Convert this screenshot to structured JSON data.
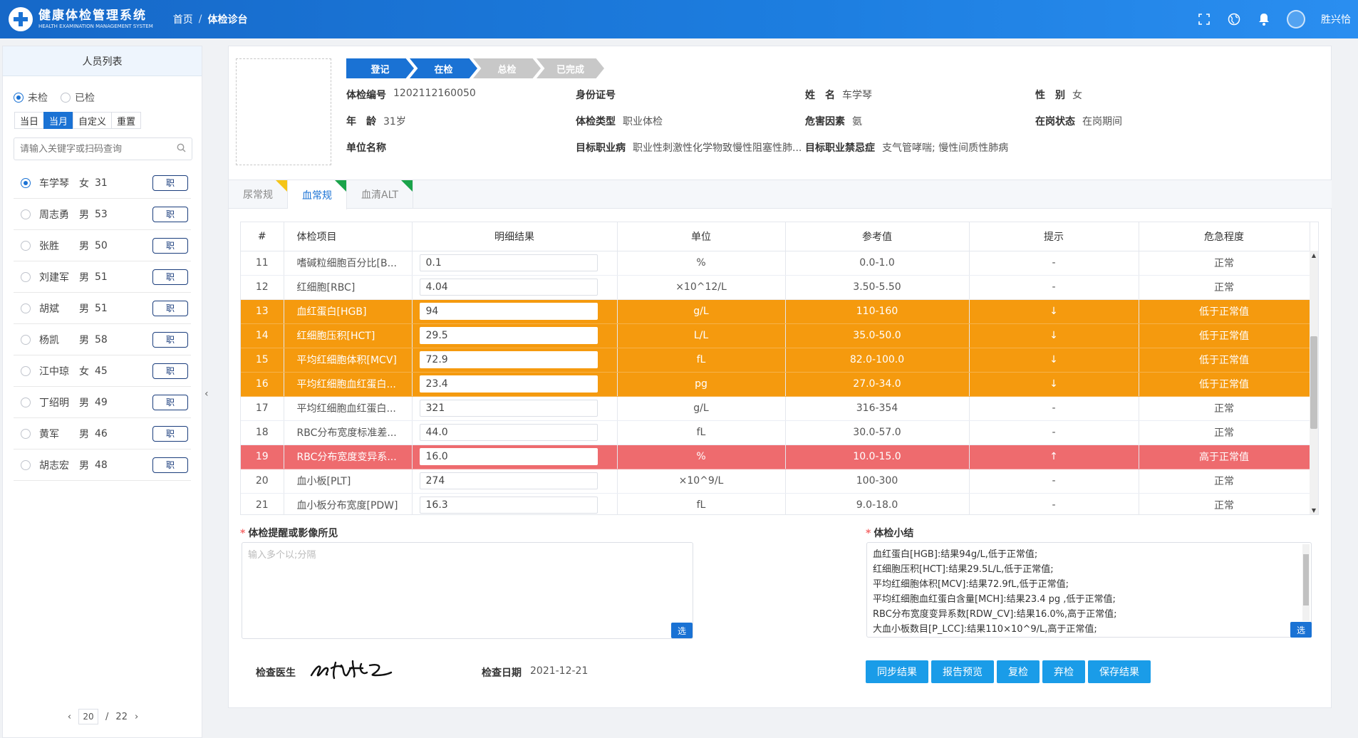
{
  "header": {
    "app_title": "健康体检管理系统",
    "app_subtitle": "HEALTH EXAMINATION MANAGEMENT SYSTEM",
    "breadcrumb_home": "首页",
    "breadcrumb_sep": "/",
    "breadcrumb_current": "体检诊台",
    "username": "胜兴恰"
  },
  "sidebar": {
    "title": "人员列表",
    "status_options": [
      "未检",
      "已检"
    ],
    "date_filters": [
      "当日",
      "当月",
      "自定义",
      "重置"
    ],
    "search_placeholder": "请输入关键字或扫码查询",
    "people": [
      {
        "name": "车学琴",
        "sex": "女",
        "age": "31",
        "tag": "职"
      },
      {
        "name": "周志勇",
        "sex": "男",
        "age": "53",
        "tag": "职"
      },
      {
        "name": "张胜",
        "sex": "男",
        "age": "50",
        "tag": "职"
      },
      {
        "name": "刘建军",
        "sex": "男",
        "age": "51",
        "tag": "职"
      },
      {
        "name": "胡斌",
        "sex": "男",
        "age": "51",
        "tag": "职"
      },
      {
        "name": "杨凯",
        "sex": "男",
        "age": "58",
        "tag": "职"
      },
      {
        "name": "江中琼",
        "sex": "女",
        "age": "45",
        "tag": "职"
      },
      {
        "name": "丁绍明",
        "sex": "男",
        "age": "49",
        "tag": "职"
      },
      {
        "name": "黄军",
        "sex": "男",
        "age": "46",
        "tag": "职"
      },
      {
        "name": "胡志宏",
        "sex": "男",
        "age": "48",
        "tag": "职"
      }
    ],
    "pager": {
      "prev": "‹",
      "current": "20",
      "sep": "/",
      "total": "22",
      "next": "›"
    }
  },
  "steps": [
    "登记",
    "在检",
    "总检",
    "已完成"
  ],
  "patient": {
    "exam_no_label": "体检编号",
    "exam_no": "1202112160050",
    "id_label": "身份证号",
    "id_value": "",
    "name_label": "姓　名",
    "name": "车学琴",
    "sex_label": "性　别",
    "sex": "女",
    "age_label": "年　龄",
    "age": "31岁",
    "type_label": "体检类型",
    "type": "职业体检",
    "hazard_label": "危害因素",
    "hazard": "氨",
    "post_label": "在岗状态",
    "post": "在岗期间",
    "unit_label": "单位名称",
    "unit": "",
    "target_label": "目标职业病",
    "target": "职业性刺激性化学物致慢性阻塞性肺...",
    "contra_label": "目标职业禁忌症",
    "contra": "支气管哮喘; 慢性间质性肺病"
  },
  "tabs": [
    "尿常规",
    "血常规",
    "血清ALT"
  ],
  "table": {
    "headers": [
      "#",
      "体检项目",
      "明细结果",
      "单位",
      "参考值",
      "提示",
      "危急程度"
    ],
    "rows": [
      {
        "no": "11",
        "item": "嗜碱粒细胞百分比[B...",
        "result": "0.1",
        "unit": "%",
        "ref": "0.0-1.0",
        "hint": "-",
        "level": "正常"
      },
      {
        "no": "12",
        "item": "红细胞[RBC]",
        "result": "4.04",
        "unit": "×10^12/L",
        "ref": "3.50-5.50",
        "hint": "-",
        "level": "正常"
      },
      {
        "no": "13",
        "item": "血红蛋白[HGB]",
        "result": "94",
        "unit": "g/L",
        "ref": "110-160",
        "hint": "↓",
        "level": "低于正常值"
      },
      {
        "no": "14",
        "item": "红细胞压积[HCT]",
        "result": "29.5",
        "unit": "L/L",
        "ref": "35.0-50.0",
        "hint": "↓",
        "level": "低于正常值"
      },
      {
        "no": "15",
        "item": "平均红细胞体积[MCV]",
        "result": "72.9",
        "unit": "fL",
        "ref": "82.0-100.0",
        "hint": "↓",
        "level": "低于正常值"
      },
      {
        "no": "16",
        "item": "平均红细胞血红蛋白...",
        "result": "23.4",
        "unit": "pg",
        "ref": "27.0-34.0",
        "hint": "↓",
        "level": "低于正常值"
      },
      {
        "no": "17",
        "item": "平均红细胞血红蛋白...",
        "result": "321",
        "unit": "g/L",
        "ref": "316-354",
        "hint": "-",
        "level": "正常"
      },
      {
        "no": "18",
        "item": "RBC分布宽度标准差...",
        "result": "44.0",
        "unit": "fL",
        "ref": "30.0-57.0",
        "hint": "-",
        "level": "正常"
      },
      {
        "no": "19",
        "item": "RBC分布宽度变异系...",
        "result": "16.0",
        "unit": "%",
        "ref": "10.0-15.0",
        "hint": "↑",
        "level": "高于正常值"
      },
      {
        "no": "20",
        "item": "血小板[PLT]",
        "result": "274",
        "unit": "×10^9/L",
        "ref": "100-300",
        "hint": "-",
        "level": "正常"
      },
      {
        "no": "21",
        "item": "血小板分布宽度[PDW]",
        "result": "16.3",
        "unit": "fL",
        "ref": "9.0-18.0",
        "hint": "-",
        "level": "正常"
      }
    ]
  },
  "remarks": {
    "title": "体检提醒或影像所见",
    "placeholder": "输入多个以;分隔",
    "select_label": "选"
  },
  "summary": {
    "title": "体检小结",
    "lines": [
      "血红蛋白[HGB]:结果94g/L,低于正常值;",
      "红细胞压积[HCT]:结果29.5L/L,低于正常值;",
      "平均红细胞体积[MCV]:结果72.9fL,低于正常值;",
      "平均红细胞血红蛋白含量[MCH]:结果23.4 pg ,低于正常值;",
      "RBC分布宽度变异系数[RDW_CV]:结果16.0%,高于正常值;",
      "大血小板数目[P_LCC]:结果110×10^9/L,高于正常值;"
    ],
    "select_label": "选"
  },
  "footer": {
    "doctor_label": "检查医生",
    "date_label": "检查日期",
    "date_value": "2021-12-21",
    "buttons": [
      "同步结果",
      "报告预览",
      "复检",
      "弃检",
      "保存结果"
    ]
  },
  "colors": {
    "primary": "#1a72d4",
    "low": "#f59a0e",
    "high": "#ee6b6e",
    "button": "#1a9ce8"
  }
}
